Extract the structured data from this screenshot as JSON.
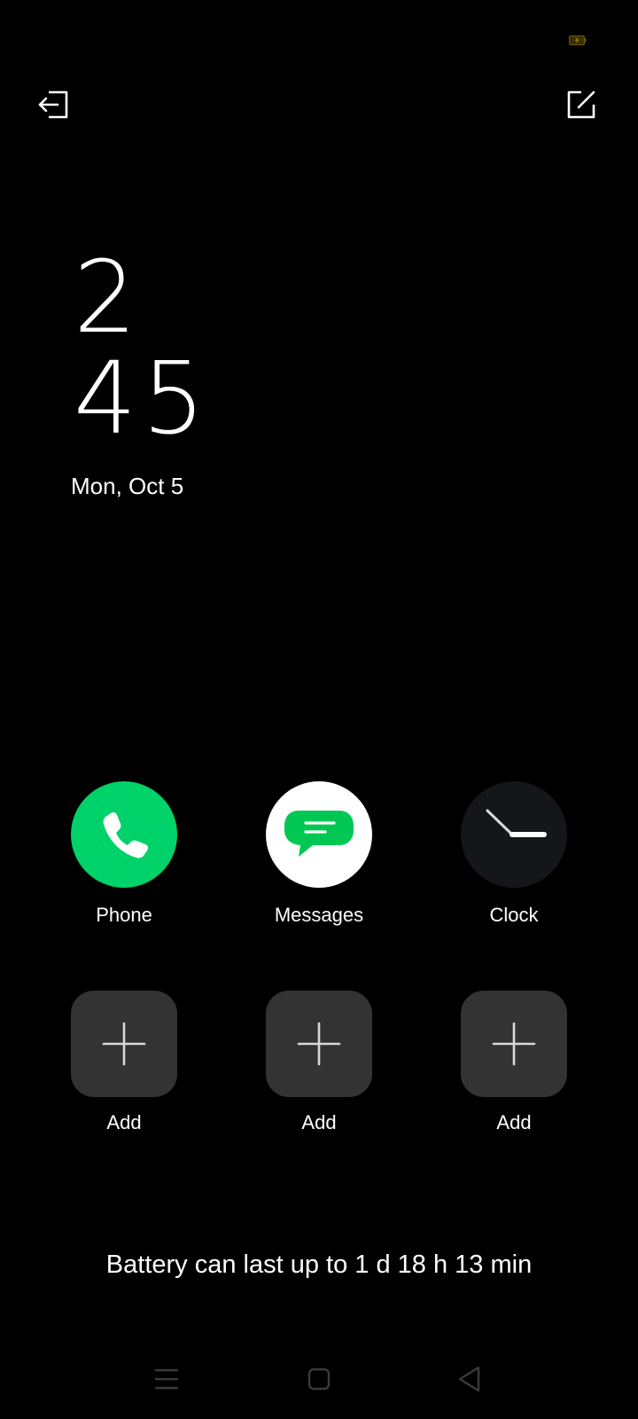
{
  "status_bar": {
    "battery_icon": "battery-charging-icon"
  },
  "top_bar": {
    "exit_icon": "exit-icon",
    "edit_icon": "edit-icon"
  },
  "clock": {
    "hour": "2",
    "minute": "45",
    "date": "Mon, Oct 5"
  },
  "apps": [
    {
      "label": "Phone",
      "icon": "phone-icon",
      "color": "#00D26A"
    },
    {
      "label": "Messages",
      "icon": "messages-icon",
      "color": "#FFFFFF",
      "accent": "#00C853"
    },
    {
      "label": "Clock",
      "icon": "clock-icon",
      "color": "#15161A"
    }
  ],
  "add_slots": [
    {
      "label": "Add",
      "icon": "plus-icon"
    },
    {
      "label": "Add",
      "icon": "plus-icon"
    },
    {
      "label": "Add",
      "icon": "plus-icon"
    }
  ],
  "battery_estimate": "Battery can last up to 1 d 18 h 13 min",
  "nav_bar": {
    "recents_icon": "menu-icon",
    "home_icon": "home-icon",
    "back_icon": "back-icon"
  },
  "colors": {
    "background": "#000000",
    "tile": "#333333",
    "nav_icon": "#3A3A3A"
  }
}
